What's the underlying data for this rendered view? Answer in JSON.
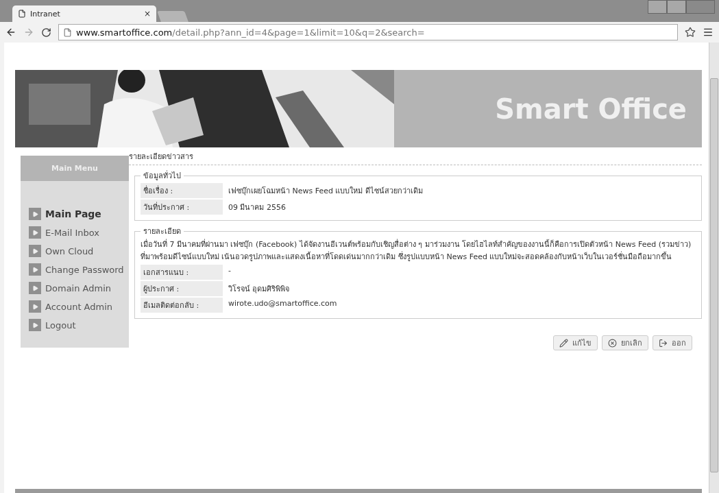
{
  "browser": {
    "tab_title": "Intranet",
    "tab_close": "×",
    "url_domain": "www.smartoffice.com",
    "url_path": "/detail.php?ann_id=4&page=1&limit=10&q=2&search="
  },
  "banner": {
    "title": "Smart Office"
  },
  "sidebar": {
    "title": "Main Menu",
    "items": [
      {
        "label": "Main Page",
        "selected": true
      },
      {
        "label": "E-Mail Inbox",
        "selected": false
      },
      {
        "label": "Own Cloud",
        "selected": false
      },
      {
        "label": "Change Password",
        "selected": false
      },
      {
        "label": "Domain Admin",
        "selected": false
      },
      {
        "label": "Account Admin",
        "selected": false
      },
      {
        "label": "Logout",
        "selected": false
      }
    ]
  },
  "page_title": "รายละเอียดข่าวสาร",
  "general": {
    "legend": "ข้อมูลทั่วไป",
    "rows": [
      {
        "label": "ชื่อเรื่อง :",
        "value": "เฟซบุ๊กเผยโฉมหน้า News Feed แบบใหม่ ดีไซน์สวยกว่าเดิม"
      },
      {
        "label": "วันที่ประกาศ :",
        "value": "09 มีนาคม 2556"
      }
    ]
  },
  "details": {
    "legend": "รายละเอียด",
    "body": "เมื่อวันที่ 7 มีนาคมที่ผ่านมา เฟซบุ๊ก (Facebook) ได้จัดงานอีเวนต์พร้อมกับเชิญสื่อต่าง ๆ มาร่วมงาน โดยไฮไลท์สำคัญของงานนี้ก็คือการเปิดตัวหน้า News Feed (รวมข่าว) ที่มาพร้อมดีไซน์แบบใหม่ เน้นอวดรูปภาพและแสดงเนื้อหาที่โดดเด่นมากกว่าเดิม ซึ่งรูปแบบหน้า News Feed แบบใหม่จะสอดคล้องกับหน้าเว็บในเวอร์ชั่นมือถือมากขึ้น",
    "rows": [
      {
        "label": "เอกสารแนบ :",
        "value": "-"
      },
      {
        "label": "ผู้ประกาศ :",
        "value": "วิโรจน์ อุดมศิริพิพิจ"
      },
      {
        "label": "อีเมลติดต่อกลับ :",
        "value": "wirote.udo@smartoffice.com"
      }
    ]
  },
  "buttons": [
    {
      "kind": "edit",
      "label": "แก้ไข"
    },
    {
      "kind": "cancel",
      "label": "ยกเลิก"
    },
    {
      "kind": "exit",
      "label": "ออก"
    }
  ]
}
